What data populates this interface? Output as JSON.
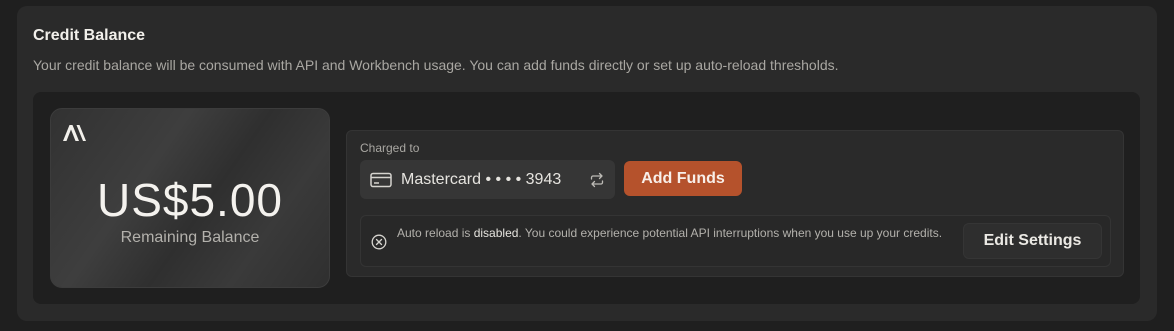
{
  "credit_balance": {
    "title": "Credit Balance",
    "description": "Your credit balance will be consumed with API and Workbench usage. You can add funds directly or set up auto-reload thresholds."
  },
  "balance_card": {
    "logo": "anthropic-logo",
    "amount": "US$5.00",
    "label": "Remaining Balance"
  },
  "payment": {
    "charged_to_label": "Charged to",
    "card_icon": "credit-card-icon",
    "card_name": "Mastercard • • • • 3943",
    "swap_icon": "swap-icon",
    "add_funds_label": "Add Funds",
    "accent_color": "#b5522c"
  },
  "auto_reload": {
    "status_icon": "x-circle-icon",
    "text_prefix": "Auto reload is ",
    "status": "disabled",
    "text_suffix": ". You could experience potential API interruptions when you use up your credits.",
    "edit_settings_label": "Edit Settings"
  }
}
